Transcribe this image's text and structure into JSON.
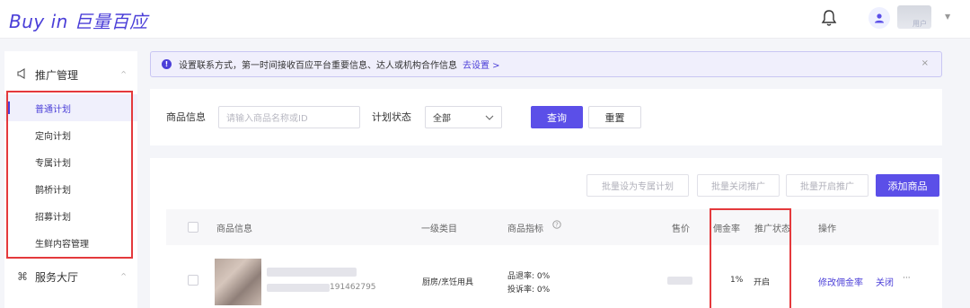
{
  "header": {
    "logo": "Buy in 巨量百应",
    "user_sub": "用户",
    "caret": "▼"
  },
  "sidebar": {
    "group1": {
      "label": "推广管理",
      "icon": "megaphone-icon"
    },
    "items": [
      {
        "label": "普通计划",
        "active": true
      },
      {
        "label": "定向计划"
      },
      {
        "label": "专属计划"
      },
      {
        "label": "鹊桥计划"
      },
      {
        "label": "招募计划"
      },
      {
        "label": "生鲜内容管理"
      }
    ],
    "group2": {
      "label": "服务大厅",
      "icon": "grid-icon"
    }
  },
  "notice": {
    "text": "设置联系方式，第一时间接收百应平台重要信息、达人或机构合作信息",
    "link": "去设置 >",
    "close": "×"
  },
  "filter": {
    "product_label": "商品信息",
    "product_placeholder": "请输入商品名称或ID",
    "status_label": "计划状态",
    "status_value": "全部",
    "query_button": "查询",
    "reset_button": "重置"
  },
  "actions": {
    "batch_exclusive": "批量设为专属计划",
    "batch_close": "批量关闭推广",
    "batch_open": "批量开启推广",
    "add_product": "添加商品"
  },
  "table": {
    "columns": [
      "商品信息",
      "一级类目",
      "商品指标",
      "售价",
      "佣金率",
      "推广状态",
      "操作"
    ],
    "rows": [
      {
        "product_id_suffix": "191462795",
        "category": "厨房/烹饪用具",
        "metric_return": "品退率: 0%",
        "metric_complaint": "投诉率: 0%",
        "commission": "1%",
        "status": "开启",
        "op_edit": "修改佣金率",
        "op_close": "关闭",
        "op_more": "···"
      }
    ]
  },
  "colors": {
    "accent": "#5b4fe8",
    "highlight_box": "#e4393c"
  }
}
